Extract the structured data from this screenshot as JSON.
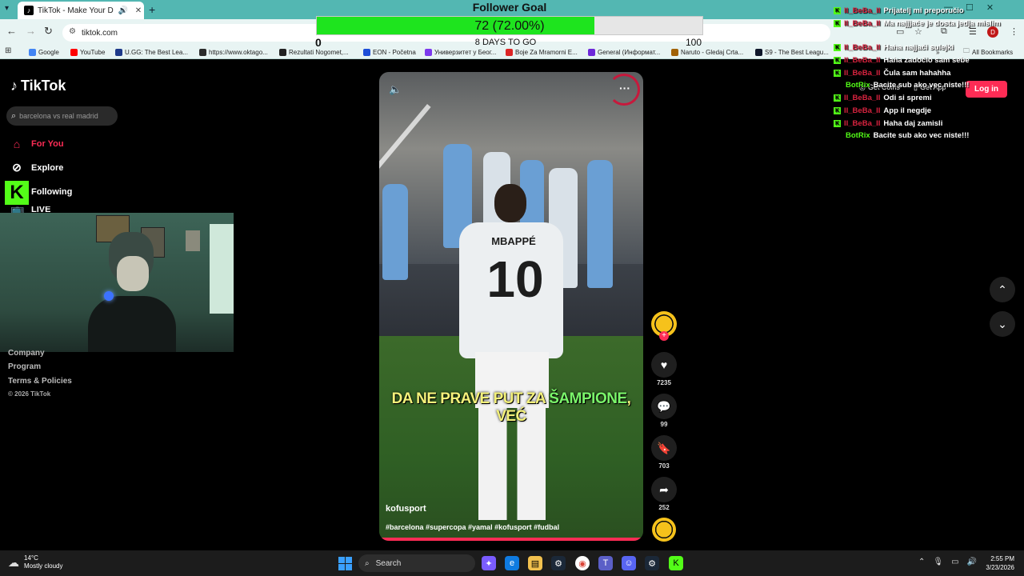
{
  "browser": {
    "tab_title": "TikTok - Make Your Day",
    "url": "tiktok.com",
    "new_tab": "+",
    "bookmarks": [
      {
        "label": "Google",
        "color": "#4285f4"
      },
      {
        "label": "YouTube",
        "color": "#ff0000"
      },
      {
        "label": "U.GG: The Best Lea...",
        "color": "#1e3a8a"
      },
      {
        "label": "https://www.oktago...",
        "color": "#2b2b2b"
      },
      {
        "label": "Rezultati Nogomet,...",
        "color": "#222222"
      },
      {
        "label": "EON - Početna",
        "color": "#1d4ed8"
      },
      {
        "label": "Универзитет у Беог...",
        "color": "#7c3aed"
      },
      {
        "label": "Boje Za Mramorni E...",
        "color": "#dc2626"
      },
      {
        "label": "General (Информат...",
        "color": "#6d28d9"
      },
      {
        "label": "Naruto - Gledaj Crta...",
        "color": "#a16207"
      },
      {
        "label": "S9 - The Best Leagu...",
        "color": "#0f172a"
      }
    ],
    "all_bookmarks": "All Bookmarks",
    "profile_initial": "D"
  },
  "goal": {
    "title": "Follower Goal",
    "progress_text": "72 (72.00%)",
    "progress": 0.72,
    "min": "0",
    "max": "100",
    "days": "8 DAYS TO GO"
  },
  "tiktok": {
    "logo": "TikTok",
    "search_placeholder": "barcelona vs real madrid",
    "nav": {
      "for_you": "For You",
      "explore": "Explore",
      "following": "Following",
      "live": "LIVE"
    },
    "footer": {
      "company": "Company",
      "program": "Program",
      "terms": "Terms & Policies",
      "copyright": "© 2026 TikTok"
    },
    "get_coins": "Get Coins",
    "get_app": "Get App",
    "login": "Log in"
  },
  "video": {
    "jersey_name": "MBAPPÉ",
    "jersey_number": "10",
    "caption_part1": "DA NE PRAVE PUT ZA ",
    "caption_part2": "ŠAMPIONE",
    "caption_part3": ", VEĆ",
    "author": "kofusport",
    "tags": "#barcelona #supercopa #yamal #kofusport #fudbal",
    "progress": 0.99,
    "likes": "7235",
    "comments": "99",
    "saves": "703",
    "shares": "252"
  },
  "chat": [
    {
      "user": "II_BeBa_II",
      "message": "Prijatelj mi preporučio",
      "bot": false
    },
    {
      "user": "II_BeBa_II",
      "message": "Ma najjjače je dosta jedja mislim",
      "bot": false
    },
    {
      "user": "II_BeBa_II",
      "message": "Haha najjači sulejki",
      "bot": false
    },
    {
      "user": "II_BeBa_II",
      "message": "Haha zadočio sam sebe",
      "bot": false
    },
    {
      "user": "II_BeBa_II",
      "message": "Čula sam hahahha",
      "bot": false
    },
    {
      "user": "BotRix",
      "message": "Bacite sub ako vec niste!!!",
      "bot": true
    },
    {
      "user": "II_BeBa_II",
      "message": "Odi si spremi",
      "bot": false
    },
    {
      "user": "II_BeBa_II",
      "message": "App il negdje",
      "bot": false
    },
    {
      "user": "II_BeBa_II",
      "message": "Haha daj zamisli",
      "bot": false
    },
    {
      "user": "BotRix",
      "message": "Bacite sub ako vec niste!!!",
      "bot": true
    }
  ],
  "taskbar": {
    "temp": "14°C",
    "weather": "Mostly cloudy",
    "search": "Search",
    "time": "2:55 PM",
    "date": "3/23/2026"
  },
  "colors": {
    "accent": "#fe2c55",
    "goal_fill": "#1ee41e",
    "kick_green": "#53fc18",
    "chrome_teal": "#53b7b2"
  }
}
